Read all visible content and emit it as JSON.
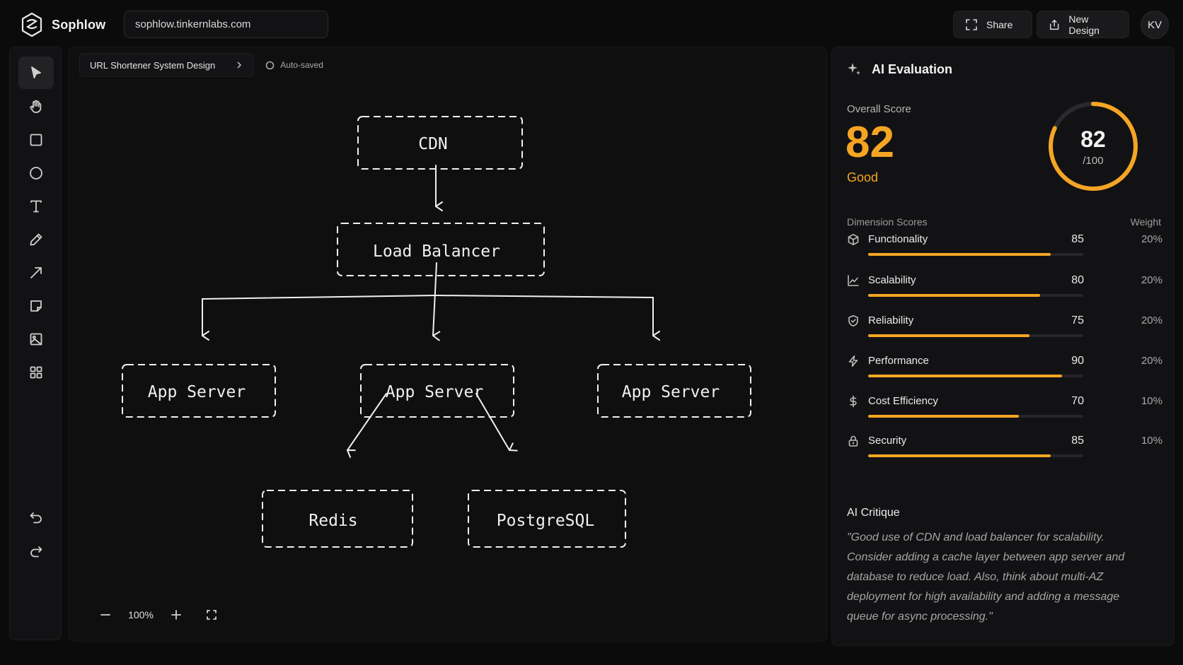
{
  "app": {
    "name": "Sophlow"
  },
  "address": {
    "url": "sophlow.tinkernlabs.com"
  },
  "header": {
    "share_label": "Share",
    "new_design_label": "New Design",
    "avatar_initials": "KV"
  },
  "tools": [
    "select",
    "hand",
    "rectangle",
    "ellipse",
    "text",
    "pencil",
    "arrow",
    "sticky-note",
    "image",
    "components",
    "undo",
    "redo"
  ],
  "breadcrumb": {
    "title": "URL Shortener System Design",
    "status": "Auto-saved"
  },
  "diagram": {
    "nodes": {
      "cdn": "CDN",
      "lb": "Load Balancer",
      "app1": "App Server",
      "app2": "App Server",
      "app3": "App Server",
      "redis": "Redis",
      "pg": "PostgreSQL"
    }
  },
  "zoom": {
    "level": "100%"
  },
  "evaluation": {
    "title": "AI Evaluation",
    "overall_label": "Overall Score",
    "score": 82,
    "score_text": "82",
    "grade": "Good",
    "max_text": "/100",
    "dimension_header": "Dimension Scores",
    "weight_header": "Weight",
    "accent": "#f5a524",
    "dimensions": [
      {
        "name": "Functionality",
        "score": 85,
        "score_text": "85",
        "weight": "20%",
        "icon": "cube-icon"
      },
      {
        "name": "Scalability",
        "score": 80,
        "score_text": "80",
        "weight": "20%",
        "icon": "trending-chart-icon"
      },
      {
        "name": "Reliability",
        "score": 75,
        "score_text": "75",
        "weight": "20%",
        "icon": "shield-icon"
      },
      {
        "name": "Performance",
        "score": 90,
        "score_text": "90",
        "weight": "20%",
        "icon": "lightning-icon"
      },
      {
        "name": "Cost Efficiency",
        "score": 70,
        "score_text": "70",
        "weight": "10%",
        "icon": "dollar-icon"
      },
      {
        "name": "Security",
        "score": 85,
        "score_text": "85",
        "weight": "10%",
        "icon": "lock-icon"
      }
    ],
    "critique_title": "AI Critique",
    "critique": "\"Good use of CDN and load balancer for scalability. Consider adding a cache layer between app server and database to reduce load. Also, think about multi-AZ deployment for high availability and adding a message queue for async processing.\""
  }
}
